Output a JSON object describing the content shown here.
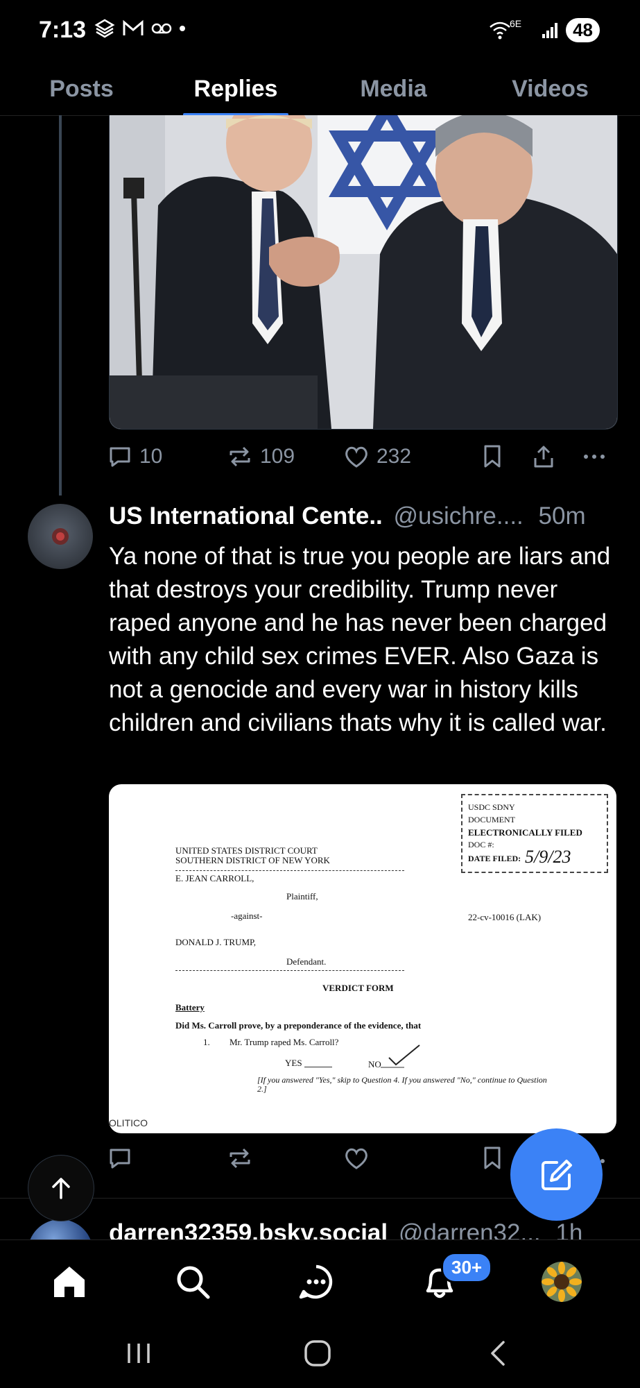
{
  "status_bar": {
    "time": "7:13",
    "battery": "48",
    "network": "6E"
  },
  "tabs": [
    {
      "label": "Posts"
    },
    {
      "label": "Replies"
    },
    {
      "label": "Media"
    },
    {
      "label": "Videos"
    }
  ],
  "post1": {
    "replies": "10",
    "reposts": "109",
    "likes": "232"
  },
  "post2": {
    "author_name": "US International Cente..",
    "author_handle": "@usichre....",
    "time": "50m",
    "text": "Ya none of that is true you people are liars and that destroys your credibility. Trump never raped anyone and he has never been charged with any child sex crimes EVER. Also Gaza is not a genocide and every war in history kills children and civilians thats why it is called war.",
    "image": {
      "stamp_lines": [
        "USDC SDNY",
        "DOCUMENT",
        "ELECTRONICALLY FILED",
        "DOC #:",
        "DATE FILED:"
      ],
      "stamp_date": "5/9/23",
      "court_line1": "UNITED STATES DISTRICT COURT",
      "court_line2": "SOUTHERN DISTRICT OF NEW YORK",
      "plaintiff_name": "E. JEAN CARROLL,",
      "plaintiff_label": "Plaintiff,",
      "against": "-against-",
      "case_no": "22-cv-10016 (LAK)",
      "defendant_name": "DONALD J. TRUMP,",
      "defendant_label": "Defendant.",
      "form_title": "VERDICT FORM",
      "section": "Battery",
      "question": "Did Ms. Carroll prove, by a preponderance of the evidence, that",
      "item_no": "1.",
      "item_text": "Mr. Trump raped Ms. Carroll?",
      "yes_label": "YES",
      "no_label": "NO",
      "instruction": "[If you answered \"Yes,\" skip to Question 4. If you answered \"No,\" continue to Question 2.]",
      "source": "OLITICO"
    }
  },
  "post3_preview": {
    "author_name": "darren32359.bsky.social",
    "author_handle": "@darren32...",
    "time": "1h"
  },
  "bottom_nav": {
    "items": [
      "home",
      "search",
      "chat",
      "notifications",
      "profile"
    ],
    "notifications_badge": "30+"
  },
  "colors": {
    "accent": "#3b82f6",
    "muted": "#8b95a3",
    "background": "#000000"
  }
}
